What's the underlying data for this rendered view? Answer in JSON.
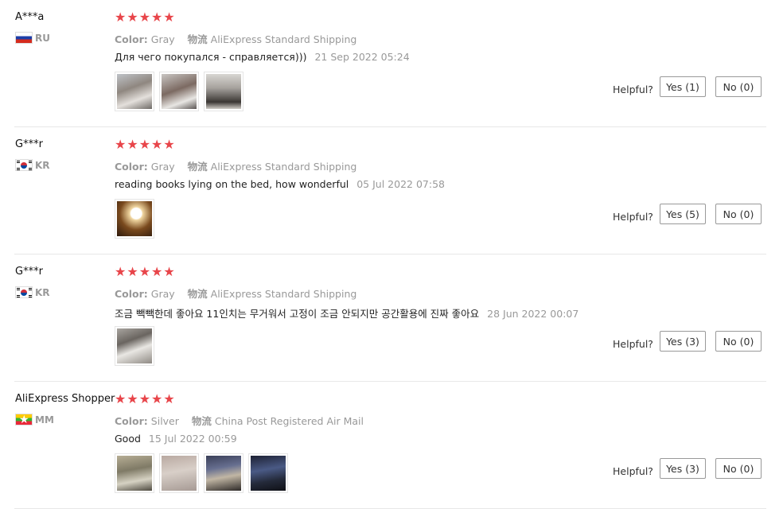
{
  "reviews": [
    {
      "user": "A***a",
      "flag": "flag-ru-icon",
      "country": "RU",
      "rating": 5,
      "color_label": "Color:",
      "color_value": "Gray",
      "ship_label": "物流",
      "ship_value": "AliExpress Standard Shipping",
      "text": "Для чего покупался - справляется)))",
      "date": "21 Sep 2022 05:24",
      "thumbs": [
        "review-photo",
        "review-photo",
        "review-photo"
      ],
      "helpful_label": "Helpful?",
      "yes_label": "Yes (1)",
      "no_label": "No (0)"
    },
    {
      "user": "G***r",
      "flag": "flag-kr-icon",
      "country": "KR",
      "rating": 5,
      "color_label": "Color:",
      "color_value": "Gray",
      "ship_label": "物流",
      "ship_value": "AliExpress Standard Shipping",
      "text": "reading books lying on the bed, how wonderful",
      "date": "05 Jul 2022 07:58",
      "thumbs": [
        "review-photo"
      ],
      "helpful_label": "Helpful?",
      "yes_label": "Yes (5)",
      "no_label": "No (0)"
    },
    {
      "user": "G***r",
      "flag": "flag-kr-icon",
      "country": "KR",
      "rating": 5,
      "color_label": "Color:",
      "color_value": "Gray",
      "ship_label": "物流",
      "ship_value": "AliExpress Standard Shipping",
      "text": "조금 빽빽한데 좋아요 11인치는 무거워서 고정이 조금 안되지만 공간활용에 진짜 좋아요",
      "date": "28 Jun 2022 00:07",
      "thumbs": [
        "review-photo"
      ],
      "helpful_label": "Helpful?",
      "yes_label": "Yes (3)",
      "no_label": "No (0)"
    },
    {
      "user": "AliExpress Shopper",
      "flag": "flag-mm-icon",
      "country": "MM",
      "rating": 5,
      "color_label": "Color:",
      "color_value": "Silver",
      "ship_label": "物流",
      "ship_value": "China Post Registered Air Mail",
      "text": "Good",
      "date": "15 Jul 2022 00:59",
      "thumbs": [
        "review-photo",
        "review-photo",
        "review-photo",
        "review-photo"
      ],
      "helpful_label": "Helpful?",
      "yes_label": "Yes (3)",
      "no_label": "No (0)"
    }
  ],
  "colors": {
    "star": "#e8454a",
    "muted": "#999999",
    "border": "#999999"
  }
}
